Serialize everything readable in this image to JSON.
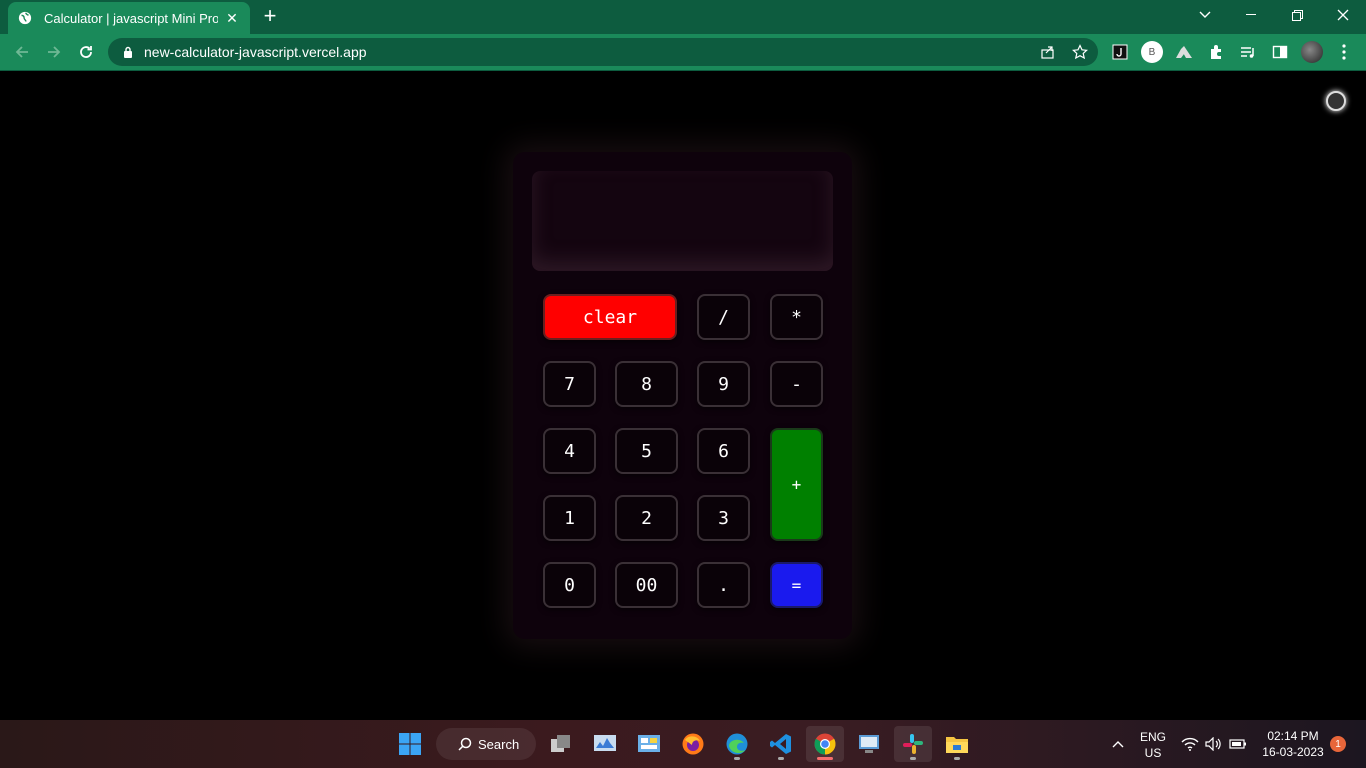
{
  "browser": {
    "tab_title": "Calculator | javascript Mini Projec",
    "tab_close": "✕",
    "new_tab": "+",
    "url": "new-calculator-javascript.vercel.app",
    "profile_initial": "B"
  },
  "calculator": {
    "display_value": "",
    "keys": {
      "clear": "clear",
      "divide": "/",
      "multiply": "*",
      "seven": "7",
      "eight": "8",
      "nine": "9",
      "minus": "-",
      "four": "4",
      "five": "5",
      "six": "6",
      "plus": "+",
      "one": "1",
      "two": "2",
      "three": "3",
      "zero": "0",
      "double_zero": "00",
      "decimal": ".",
      "equals": "="
    },
    "colors": {
      "clear": "#ff0000",
      "plus": "#008000",
      "equals": "#1a1aee",
      "body": "#0e020c"
    }
  },
  "taskbar": {
    "search_label": "Search",
    "lang_top": "ENG",
    "lang_bottom": "US",
    "time": "02:14 PM",
    "date": "16-03-2023",
    "notification_count": "1"
  }
}
